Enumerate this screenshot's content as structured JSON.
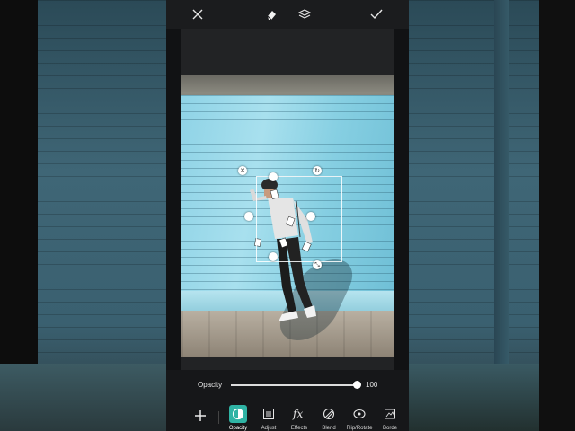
{
  "toolbar_top": {
    "close_icon": "close-icon",
    "eraser_icon": "eraser-icon",
    "layers_icon": "layers-icon",
    "apply_icon": "checkmark-icon"
  },
  "opacity": {
    "label": "Opacity",
    "value": "100",
    "fraction": 1.0
  },
  "tools": [
    {
      "label": "Opacity",
      "icon": "opacity-icon",
      "active": true
    },
    {
      "label": "Adjust",
      "icon": "adjust-icon",
      "active": false
    },
    {
      "label": "Effects",
      "icon": "fx-icon",
      "active": false
    },
    {
      "label": "Blend",
      "icon": "blend-icon",
      "active": false
    },
    {
      "label": "Flip/Rotate",
      "icon": "flip-rotate-icon",
      "active": false
    },
    {
      "label": "Borde",
      "icon": "border-icon",
      "active": false
    }
  ],
  "colors": {
    "accent": "#2fb3a4",
    "background": "#111214"
  }
}
